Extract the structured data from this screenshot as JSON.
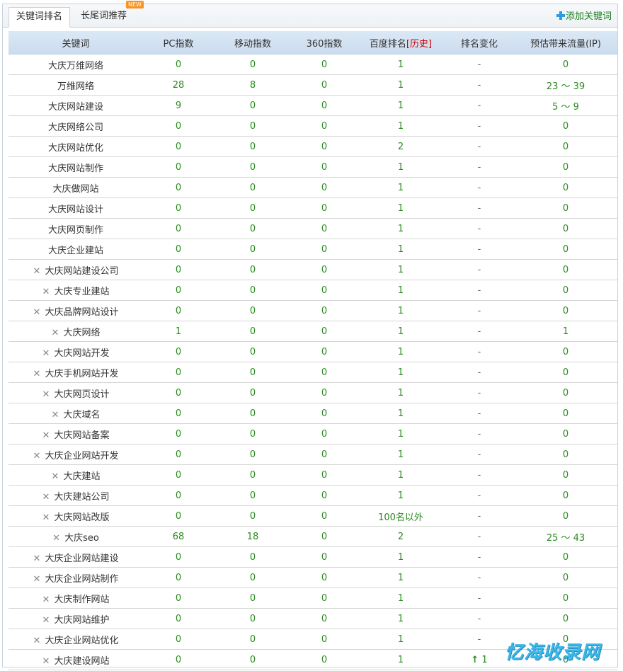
{
  "tabs": [
    {
      "label": "关键词排名",
      "active": true
    },
    {
      "label": "长尾词推荐",
      "badge": "NEW"
    }
  ],
  "add_keyword_label": "添加关键词",
  "columns": [
    "关键词",
    "PC指数",
    "移动指数",
    "360指数",
    "百度排名",
    "排名变化",
    "预估带来流量(IP)"
  ],
  "baidu_history_label": "[历史]",
  "rows": [
    {
      "kw": "大庆万维网络",
      "deletable": false,
      "pc": "0",
      "mobile": "0",
      "s360": "0",
      "baidu": "1",
      "change": "-",
      "traffic": "0"
    },
    {
      "kw": "万维网络",
      "deletable": false,
      "pc": "28",
      "mobile": "8",
      "s360": "0",
      "baidu": "1",
      "change": "-",
      "traffic": "23 ～ 39"
    },
    {
      "kw": "大庆网站建设",
      "deletable": false,
      "pc": "9",
      "mobile": "0",
      "s360": "0",
      "baidu": "1",
      "change": "-",
      "traffic": "5 ～ 9"
    },
    {
      "kw": "大庆网络公司",
      "deletable": false,
      "pc": "0",
      "mobile": "0",
      "s360": "0",
      "baidu": "1",
      "change": "-",
      "traffic": "0"
    },
    {
      "kw": "大庆网站优化",
      "deletable": false,
      "pc": "0",
      "mobile": "0",
      "s360": "0",
      "baidu": "2",
      "change": "-",
      "traffic": "0"
    },
    {
      "kw": "大庆网站制作",
      "deletable": false,
      "pc": "0",
      "mobile": "0",
      "s360": "0",
      "baidu": "1",
      "change": "-",
      "traffic": "0"
    },
    {
      "kw": "大庆做网站",
      "deletable": false,
      "pc": "0",
      "mobile": "0",
      "s360": "0",
      "baidu": "1",
      "change": "-",
      "traffic": "0"
    },
    {
      "kw": "大庆网站设计",
      "deletable": false,
      "pc": "0",
      "mobile": "0",
      "s360": "0",
      "baidu": "1",
      "change": "-",
      "traffic": "0"
    },
    {
      "kw": "大庆网页制作",
      "deletable": false,
      "pc": "0",
      "mobile": "0",
      "s360": "0",
      "baidu": "1",
      "change": "-",
      "traffic": "0"
    },
    {
      "kw": "大庆企业建站",
      "deletable": false,
      "pc": "0",
      "mobile": "0",
      "s360": "0",
      "baidu": "1",
      "change": "-",
      "traffic": "0"
    },
    {
      "kw": "大庆网站建设公司",
      "deletable": true,
      "pc": "0",
      "mobile": "0",
      "s360": "0",
      "baidu": "1",
      "change": "-",
      "traffic": "0"
    },
    {
      "kw": "大庆专业建站",
      "deletable": true,
      "pc": "0",
      "mobile": "0",
      "s360": "0",
      "baidu": "1",
      "change": "-",
      "traffic": "0"
    },
    {
      "kw": "大庆品牌网站设计",
      "deletable": true,
      "pc": "0",
      "mobile": "0",
      "s360": "0",
      "baidu": "1",
      "change": "-",
      "traffic": "0"
    },
    {
      "kw": "大庆网络",
      "deletable": true,
      "pc": "1",
      "mobile": "0",
      "s360": "0",
      "baidu": "1",
      "change": "-",
      "traffic": "1"
    },
    {
      "kw": "大庆网站开发",
      "deletable": true,
      "pc": "0",
      "mobile": "0",
      "s360": "0",
      "baidu": "1",
      "change": "-",
      "traffic": "0"
    },
    {
      "kw": "大庆手机网站开发",
      "deletable": true,
      "pc": "0",
      "mobile": "0",
      "s360": "0",
      "baidu": "1",
      "change": "-",
      "traffic": "0"
    },
    {
      "kw": "大庆网页设计",
      "deletable": true,
      "pc": "0",
      "mobile": "0",
      "s360": "0",
      "baidu": "1",
      "change": "-",
      "traffic": "0"
    },
    {
      "kw": "大庆域名",
      "deletable": true,
      "pc": "0",
      "mobile": "0",
      "s360": "0",
      "baidu": "1",
      "change": "-",
      "traffic": "0"
    },
    {
      "kw": "大庆网站备案",
      "deletable": true,
      "pc": "0",
      "mobile": "0",
      "s360": "0",
      "baidu": "1",
      "change": "-",
      "traffic": "0"
    },
    {
      "kw": "大庆企业网站开发",
      "deletable": true,
      "pc": "0",
      "mobile": "0",
      "s360": "0",
      "baidu": "1",
      "change": "-",
      "traffic": "0"
    },
    {
      "kw": "大庆建站",
      "deletable": true,
      "pc": "0",
      "mobile": "0",
      "s360": "0",
      "baidu": "1",
      "change": "-",
      "traffic": "0"
    },
    {
      "kw": "大庆建站公司",
      "deletable": true,
      "pc": "0",
      "mobile": "0",
      "s360": "0",
      "baidu": "1",
      "change": "-",
      "traffic": "0"
    },
    {
      "kw": "大庆网站改版",
      "deletable": true,
      "pc": "0",
      "mobile": "0",
      "s360": "0",
      "baidu": "100名以外",
      "change": "-",
      "traffic": "0"
    },
    {
      "kw": "大庆seo",
      "deletable": true,
      "pc": "68",
      "mobile": "18",
      "s360": "0",
      "baidu": "2",
      "change": "-",
      "traffic": "25 ～ 43"
    },
    {
      "kw": "大庆企业网站建设",
      "deletable": true,
      "pc": "0",
      "mobile": "0",
      "s360": "0",
      "baidu": "1",
      "change": "-",
      "traffic": "0"
    },
    {
      "kw": "大庆企业网站制作",
      "deletable": true,
      "pc": "0",
      "mobile": "0",
      "s360": "0",
      "baidu": "1",
      "change": "-",
      "traffic": "0"
    },
    {
      "kw": "大庆制作网站",
      "deletable": true,
      "pc": "0",
      "mobile": "0",
      "s360": "0",
      "baidu": "1",
      "change": "-",
      "traffic": "0"
    },
    {
      "kw": "大庆网站维护",
      "deletable": true,
      "pc": "0",
      "mobile": "0",
      "s360": "0",
      "baidu": "1",
      "change": "-",
      "traffic": "0"
    },
    {
      "kw": "大庆企业网站优化",
      "deletable": true,
      "pc": "0",
      "mobile": "0",
      "s360": "0",
      "baidu": "1",
      "change": "-",
      "traffic": "0"
    },
    {
      "kw": "大庆建设网站",
      "deletable": true,
      "pc": "0",
      "mobile": "0",
      "s360": "0",
      "baidu": "1",
      "change": "1",
      "change_up": true,
      "traffic": "0"
    }
  ],
  "icons": {
    "delete": "close-icon",
    "add": "plus-icon",
    "rank_up": "arrow-up-icon"
  },
  "colors": {
    "value_green": "#2a8a1f",
    "history_red": "#cc0000",
    "header_blue": "#cbdcef",
    "badge_orange": "#f7931e"
  },
  "watermark": "忆海收录网"
}
